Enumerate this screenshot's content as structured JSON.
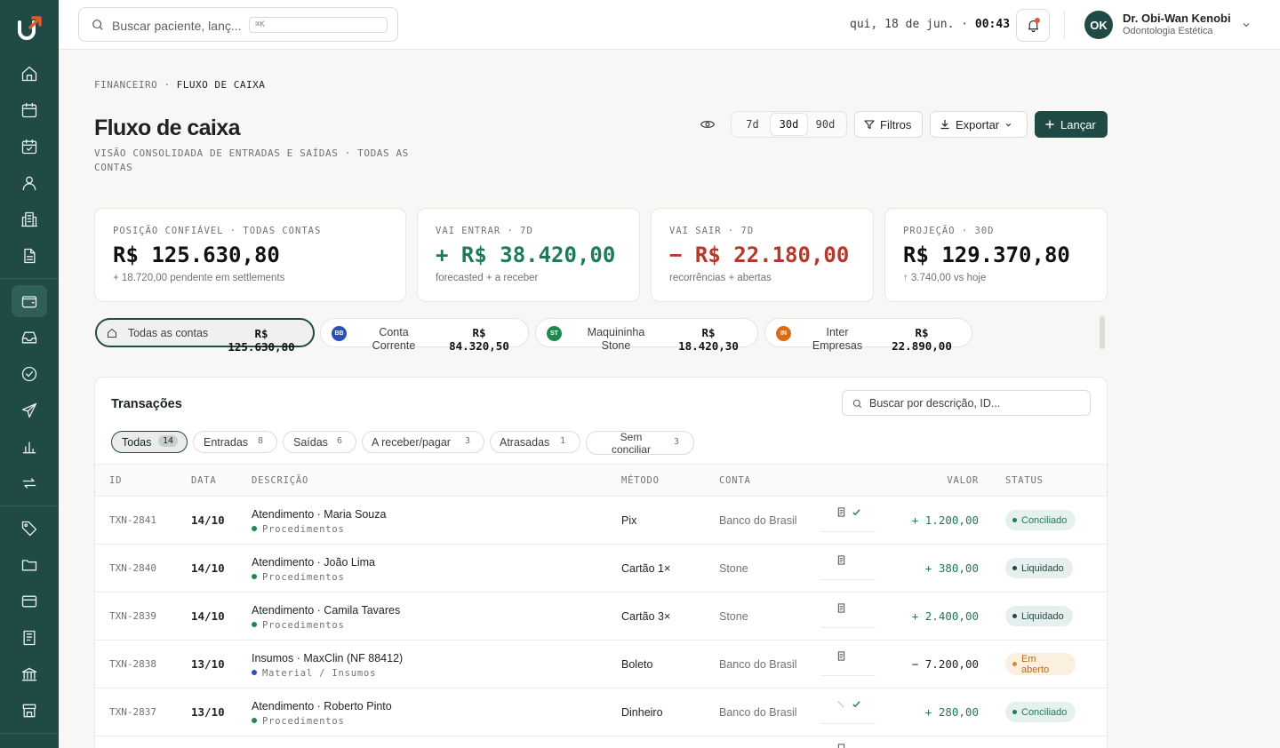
{
  "sidebar": {
    "logo": "U",
    "items": [
      {
        "icon": "home-icon",
        "label": "Início"
      },
      {
        "icon": "calendar-icon",
        "label": "Agenda"
      },
      {
        "icon": "calendar-check-icon",
        "label": "Consultas"
      },
      {
        "icon": "user-icon",
        "label": "Pacientes"
      },
      {
        "icon": "building-icon",
        "label": "Clínica"
      },
      {
        "icon": "document-icon",
        "label": "Documentos"
      },
      {
        "icon": "wallet-icon",
        "label": "Financeiro",
        "active": true
      },
      {
        "icon": "inbox-icon",
        "label": "Caixa de entrada"
      },
      {
        "icon": "check-circle-icon",
        "label": "Tarefas"
      },
      {
        "icon": "send-icon",
        "label": "Mensagens"
      },
      {
        "icon": "bar-chart-icon",
        "label": "Relatórios"
      },
      {
        "icon": "repeat-icon",
        "label": "Recorrências"
      },
      {
        "icon": "tag-icon",
        "label": "Etiquetas"
      },
      {
        "icon": "folder-icon",
        "label": "Arquivos"
      },
      {
        "icon": "credit-card-icon",
        "label": "Cartões"
      },
      {
        "icon": "receipt-icon",
        "label": "Notas"
      },
      {
        "icon": "bank-icon",
        "label": "Bancos"
      },
      {
        "icon": "store-icon",
        "label": "Loja"
      }
    ]
  },
  "topbar": {
    "search_placeholder": "Buscar paciente, lanç...",
    "search_shortcut": "⌘K",
    "date": "qui, 18 de jun. ·",
    "time": "00:43",
    "user_initials": "OK",
    "user_name": "Dr. Obi-Wan Kenobi",
    "user_role": "Odontologia Estética"
  },
  "header": {
    "breadcrumb_parent": "FINANCEIRO",
    "breadcrumb_sep": " · ",
    "breadcrumb_current": "FLUXO DE CAIXA",
    "title": "Fluxo de caixa",
    "subtitle": "VISÃO CONSOLIDADA DE ENTRADAS E SAÍDAS · TODAS AS CONTAS",
    "periods": [
      "7d",
      "30d",
      "90d"
    ],
    "selected_period": "30d",
    "filters_label": "Filtros",
    "export_label": "Exportar",
    "add_label": "Lançar"
  },
  "kpis": [
    {
      "label": "POSIÇÃO CONFIÁVEL · TODAS CONTAS",
      "value": "R$ 125.630,80",
      "note": "+ 18.720,00 pendente em settlements",
      "tone": "neutral"
    },
    {
      "label": "VAI ENTRAR · 7D",
      "value": "+ R$ 38.420,00",
      "note": "forecasted + a receber",
      "tone": "positive"
    },
    {
      "label": "VAI SAIR · 7D",
      "value": "− R$ 22.180,00",
      "note": "recorrências + abertas",
      "tone": "negative"
    },
    {
      "label": "PROJEÇÃO · 30D",
      "value": "R$ 129.370,80",
      "note": "↑ 3.740,00 vs hoje",
      "tone": "neutral"
    }
  ],
  "accounts": [
    {
      "badge": "",
      "name": "Todas as contas",
      "value": "R$ 125.630,80",
      "selected": true
    },
    {
      "badge": "BB",
      "color": "#2b4fb8",
      "name": "Conta Corrente",
      "value": "R$ 84.320,50"
    },
    {
      "badge": "ST",
      "color": "#1e8a4a",
      "name": "Maquininha Stone",
      "value": "R$ 18.420,30"
    },
    {
      "badge": "IN",
      "color": "#e06a12",
      "name": "Inter Empresas",
      "value": "R$ 22.890,00"
    }
  ],
  "transactions": {
    "title": "Transações",
    "search_placeholder": "Buscar por descrição, ID...",
    "filters": [
      {
        "label": "Todas",
        "count": "14",
        "selected": true
      },
      {
        "label": "Entradas",
        "count": "8"
      },
      {
        "label": "Saídas",
        "count": "6"
      },
      {
        "label": "A receber/pagar",
        "count": "3"
      },
      {
        "label": "Atrasadas",
        "count": "1"
      },
      {
        "label": "Sem conciliar",
        "count": "3"
      }
    ],
    "columns": [
      "ID",
      "DATA",
      "DESCRIÇÃO",
      "MÉTODO",
      "CONTA",
      "VALOR",
      "STATUS"
    ],
    "rows": [
      {
        "id": "TXN-2841",
        "date": "14/10",
        "desc": "Atendimento · Maria Souza",
        "cat": "Procedimentos",
        "cat_color": "#1e8a4a",
        "method": "Pix",
        "account": "Banco do Brasil",
        "value": "+ 1.200,00",
        "status": "Conciliado",
        "status_type": "ok",
        "has_doc": true,
        "has_check": true
      },
      {
        "id": "TXN-2840",
        "date": "14/10",
        "desc": "Atendimento · João Lima",
        "cat": "Procedimentos",
        "cat_color": "#1e8a4a",
        "method": "Cartão 1×",
        "account": "Stone",
        "value": "+ 380,00",
        "status": "Liquidado",
        "status_type": "liq",
        "has_doc": true,
        "has_check": false
      },
      {
        "id": "TXN-2839",
        "date": "14/10",
        "desc": "Atendimento · Camila Tavares",
        "cat": "Procedimentos",
        "cat_color": "#1e8a4a",
        "method": "Cartão 3×",
        "account": "Stone",
        "value": "+ 2.400,00",
        "status": "Liquidado",
        "status_type": "liq",
        "has_doc": true,
        "has_check": false
      },
      {
        "id": "TXN-2838",
        "date": "13/10",
        "desc": "Insumos · MaxClin (NF 88412)",
        "cat": "Material / Insumos",
        "cat_color": "#2b4fb8",
        "method": "Boleto",
        "account": "Banco do Brasil",
        "value": "− 7.200,00",
        "status": "Em aberto",
        "status_type": "open",
        "has_doc": true,
        "has_check": false
      },
      {
        "id": "TXN-2837",
        "date": "13/10",
        "desc": "Atendimento · Roberto Pinto",
        "cat": "Procedimentos",
        "cat_color": "#1e8a4a",
        "method": "Dinheiro",
        "account": "Banco do Brasil",
        "value": "+ 280,00",
        "status": "Conciliado",
        "status_type": "ok",
        "has_doc": false,
        "has_check": true
      }
    ]
  },
  "colors": {
    "brand": "#1f4a45",
    "positive": "#1e7a5a",
    "negative": "#b8372a",
    "warning": "#d98a2b"
  }
}
